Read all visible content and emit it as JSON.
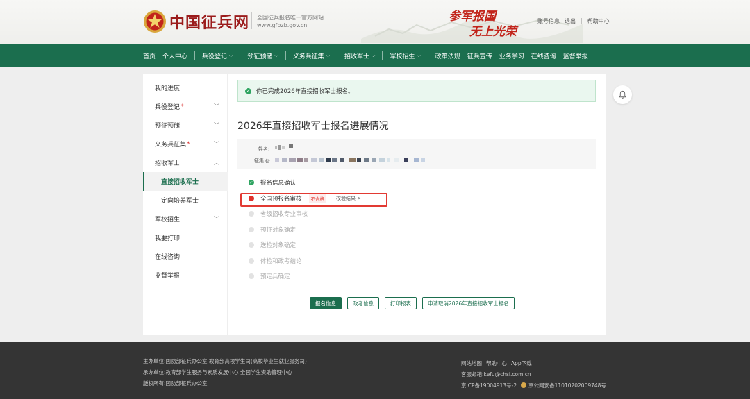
{
  "header": {
    "site_name": "中国征兵网",
    "subtitle": "全国征兵报名唯一官方网站",
    "domain": "www.gfbzb.gov.cn",
    "slogan_line1": "参军报国",
    "slogan_line2": "无上光荣",
    "links": [
      "账号信息",
      "退出",
      "帮助中心"
    ]
  },
  "nav": {
    "items": [
      {
        "label": "首页",
        "has_dropdown": false
      },
      {
        "label": "个人中心",
        "has_dropdown": false
      },
      {
        "label": "兵役登记",
        "has_dropdown": true
      },
      {
        "label": "预征预储",
        "has_dropdown": true
      },
      {
        "label": "义务兵征集",
        "has_dropdown": true
      },
      {
        "label": "招收军士",
        "has_dropdown": true
      },
      {
        "label": "军校招生",
        "has_dropdown": true
      },
      {
        "label": "政策法规",
        "has_dropdown": false
      },
      {
        "label": "征兵宣传",
        "has_dropdown": false
      },
      {
        "label": "业务学习",
        "has_dropdown": false
      },
      {
        "label": "在线咨询",
        "has_dropdown": false
      },
      {
        "label": "监督举报",
        "has_dropdown": false
      }
    ]
  },
  "sidebar": {
    "items": [
      {
        "label": "我的进度"
      },
      {
        "label": "兵役登记",
        "required": "*",
        "chevron": "down"
      },
      {
        "label": "预征预储",
        "chevron": "down"
      },
      {
        "label": "义务兵征集",
        "required": "*",
        "chevron": "down"
      },
      {
        "label": "招收军士",
        "chevron": "up"
      },
      {
        "label": "直接招收军士",
        "sub": true,
        "active": true
      },
      {
        "label": "定向培养军士",
        "sub": true
      },
      {
        "label": "军校招生",
        "chevron": "down"
      },
      {
        "label": "我要打印"
      },
      {
        "label": "在线咨询"
      },
      {
        "label": "监督举报"
      }
    ]
  },
  "main": {
    "notice": "你已完成2026年直接招收军士报名。",
    "title": "2026年直接招收军士报名进展情况",
    "info": {
      "name_label": "姓名:",
      "region_label": "征集地:"
    },
    "steps": [
      {
        "label": "报名信息确认",
        "status": "done"
      },
      {
        "label": "全国预报名审核",
        "status": "fail",
        "badge": "不合格",
        "link": "校验结果 >"
      },
      {
        "label": "省级招收专业审核",
        "status": "pending"
      },
      {
        "label": "预征对象确定",
        "status": "pending"
      },
      {
        "label": "送检对象确定",
        "status": "pending"
      },
      {
        "label": "体检和政考结论",
        "status": "pending"
      },
      {
        "label": "预定兵确定",
        "status": "pending"
      }
    ],
    "buttons": [
      {
        "label": "报名信息",
        "primary": true
      },
      {
        "label": "政考信息",
        "primary": false
      },
      {
        "label": "打印报表",
        "primary": false
      },
      {
        "label": "申请取消2026年直接招收军士报名",
        "primary": false
      }
    ]
  },
  "footer": {
    "left": [
      "主办单位:国防部征兵办公室  教育部高校学生司(高校毕业生就业服务司)",
      "承办单位:教育部学生服务与素质发展中心  全国学生资助管理中心",
      "版权所有:国防部征兵办公室"
    ],
    "right_links": [
      "网站地图",
      "帮助中心",
      "App下载"
    ],
    "email": "客服邮箱:kefu@chsi.com.cn",
    "icp": "京ICP备19004913号-2",
    "police": "京公网安备11010202009748号"
  },
  "colors": {
    "brand_green": "#1b6e4e",
    "brand_red": "#9b1c1c",
    "success": "#2fa461",
    "error": "#e0302a",
    "footer_bg": "#343434"
  }
}
